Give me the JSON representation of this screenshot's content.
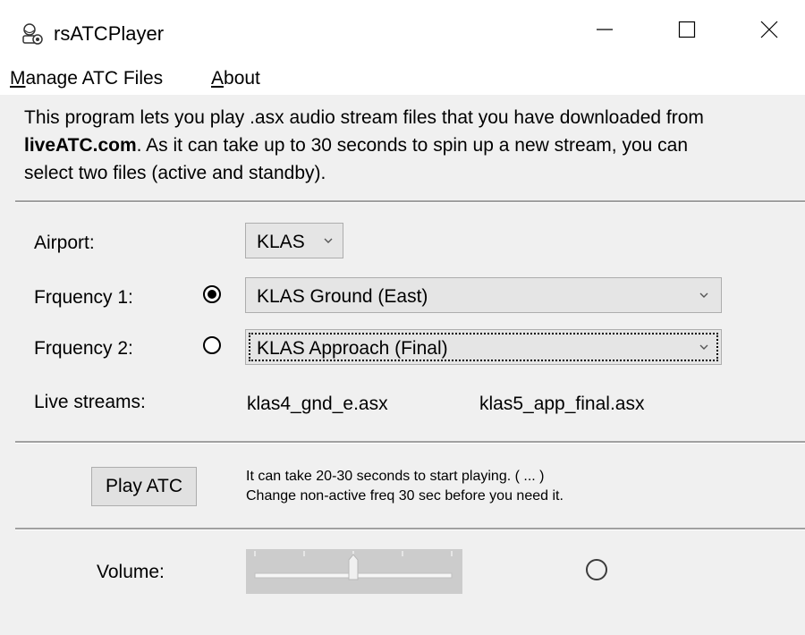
{
  "window": {
    "title": "rsATCPlayer",
    "icon": "app-icon",
    "controls": {
      "minimize": "minimize-icon",
      "maximize": "maximize-icon",
      "close": "close-icon"
    }
  },
  "menu": {
    "items": [
      {
        "accel": "M",
        "rest": "anage ATC Files"
      },
      {
        "accel": "A",
        "rest": "bout"
      }
    ]
  },
  "description": {
    "line1": "This program lets you play .asx audio stream files that you have downloaded from",
    "link": "liveATC.com",
    "line2_rest": ". As it can take up to 30 seconds to spin up a new stream, you can",
    "line3": "select two files (active and standby)."
  },
  "form": {
    "airport_label": "Airport:",
    "airport_value": "KLAS",
    "freq1_label": "Frquency 1:",
    "freq1_value": "KLAS Ground (East)",
    "freq1_selected": true,
    "freq2_label": "Frquency 2:",
    "freq2_value": "KLAS Approach (Final)",
    "freq2_selected": false,
    "live_label": "Live streams:",
    "live_stream_1": "klas4_gnd_e.asx",
    "live_stream_2": "klas5_app_final.asx"
  },
  "playback": {
    "play_button": "Play ATC",
    "hint_line1": "It can take 20-30 seconds to start playing. ( ... )",
    "hint_line2": "Change non-active freq 30 sec before you need it."
  },
  "volume": {
    "label": "Volume:",
    "level": 0.5,
    "status_indicator": "circle-icon"
  },
  "colors": {
    "window_bg": "#f0f0f0",
    "titlebar_bg": "#ffffff",
    "control_bg": "#e5e5e5",
    "border": "#adadad"
  }
}
